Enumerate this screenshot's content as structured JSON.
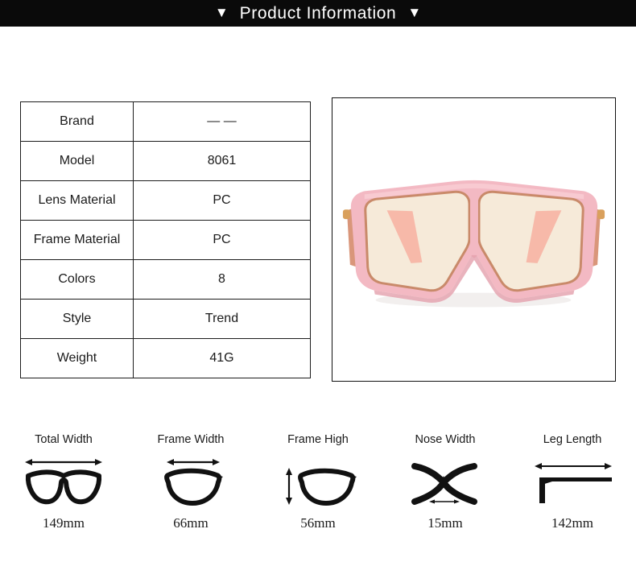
{
  "header": {
    "left_marker": "▼",
    "title": "Product Information",
    "right_marker": "▼",
    "background": "#0a0a0a",
    "text_color": "#ffffff"
  },
  "spec_table": {
    "rows": [
      {
        "label": "Brand",
        "value": "— —"
      },
      {
        "label": "Model",
        "value": "8061"
      },
      {
        "label": "Lens Material",
        "value": "PC"
      },
      {
        "label": "Frame Material",
        "value": "PC"
      },
      {
        "label": "Colors",
        "value": "8"
      },
      {
        "label": "Style",
        "value": "Trend"
      },
      {
        "label": "Weight",
        "value": "41G"
      }
    ],
    "border_color": "#1c1c1c"
  },
  "product_image": {
    "alt": "pink oversized shield sunglasses",
    "frame_color": "#f3b9c3",
    "frame_shadow_color": "#e3a0ac",
    "lens_color": "#f6ead9",
    "lens_rim_color": "#c98a6a",
    "temple_color": "#d9967a",
    "inner_temple_color": "#f7b6a6",
    "hinge_color": "#d9a05c",
    "background": "#ffffff"
  },
  "measurements": [
    {
      "label": "Total Width",
      "value": "149mm",
      "icon": "full-eyeglasses-icon"
    },
    {
      "label": "Frame Width",
      "value": "66mm",
      "icon": "single-lens-width-icon"
    },
    {
      "label": "Frame High",
      "value": "56mm",
      "icon": "single-lens-height-icon"
    },
    {
      "label": "Nose Width",
      "value": "15mm",
      "icon": "nose-bridge-icon"
    },
    {
      "label": "Leg Length",
      "value": "142mm",
      "icon": "temple-arm-icon"
    }
  ]
}
